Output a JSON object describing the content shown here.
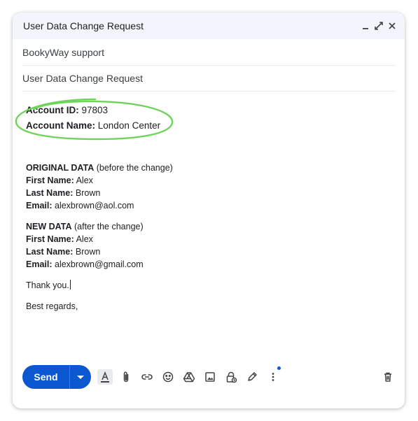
{
  "window": {
    "title": "User Data Change Request"
  },
  "compose": {
    "to": "BookyWay support",
    "subject": "User Data Change Request"
  },
  "body": {
    "account_id_label": "Account ID:",
    "account_id": "97803",
    "account_name_label": "Account Name:",
    "account_name": "London Center",
    "original_heading": "ORIGINAL DATA",
    "original_note": "(before the change)",
    "first_name_label": "First Name:",
    "last_name_label": "Last Name:",
    "email_label": "Email:",
    "original_first": "Alex",
    "original_last": "Brown",
    "original_email": "alexbrown@aol.com",
    "new_heading": "NEW DATA",
    "new_note": "(after the change)",
    "new_first": "Alex",
    "new_last": "Brown",
    "new_email": "alexbrown@gmail.com",
    "thanks": "Thank you.",
    "regards": "Best regards,"
  },
  "toolbar": {
    "send_label": "Send"
  },
  "colors": {
    "accent": "#0b57d0",
    "annotation": "#6fd35c",
    "titlebar": "#f2f6fc"
  },
  "icons": [
    "minimize-icon",
    "expand-icon",
    "close-icon",
    "chevron-down-icon",
    "text-format-icon",
    "paperclip-icon",
    "link-icon",
    "emoji-icon",
    "drive-icon",
    "image-icon",
    "lock-clock-icon",
    "pen-icon",
    "more-vert-icon",
    "trash-icon"
  ]
}
